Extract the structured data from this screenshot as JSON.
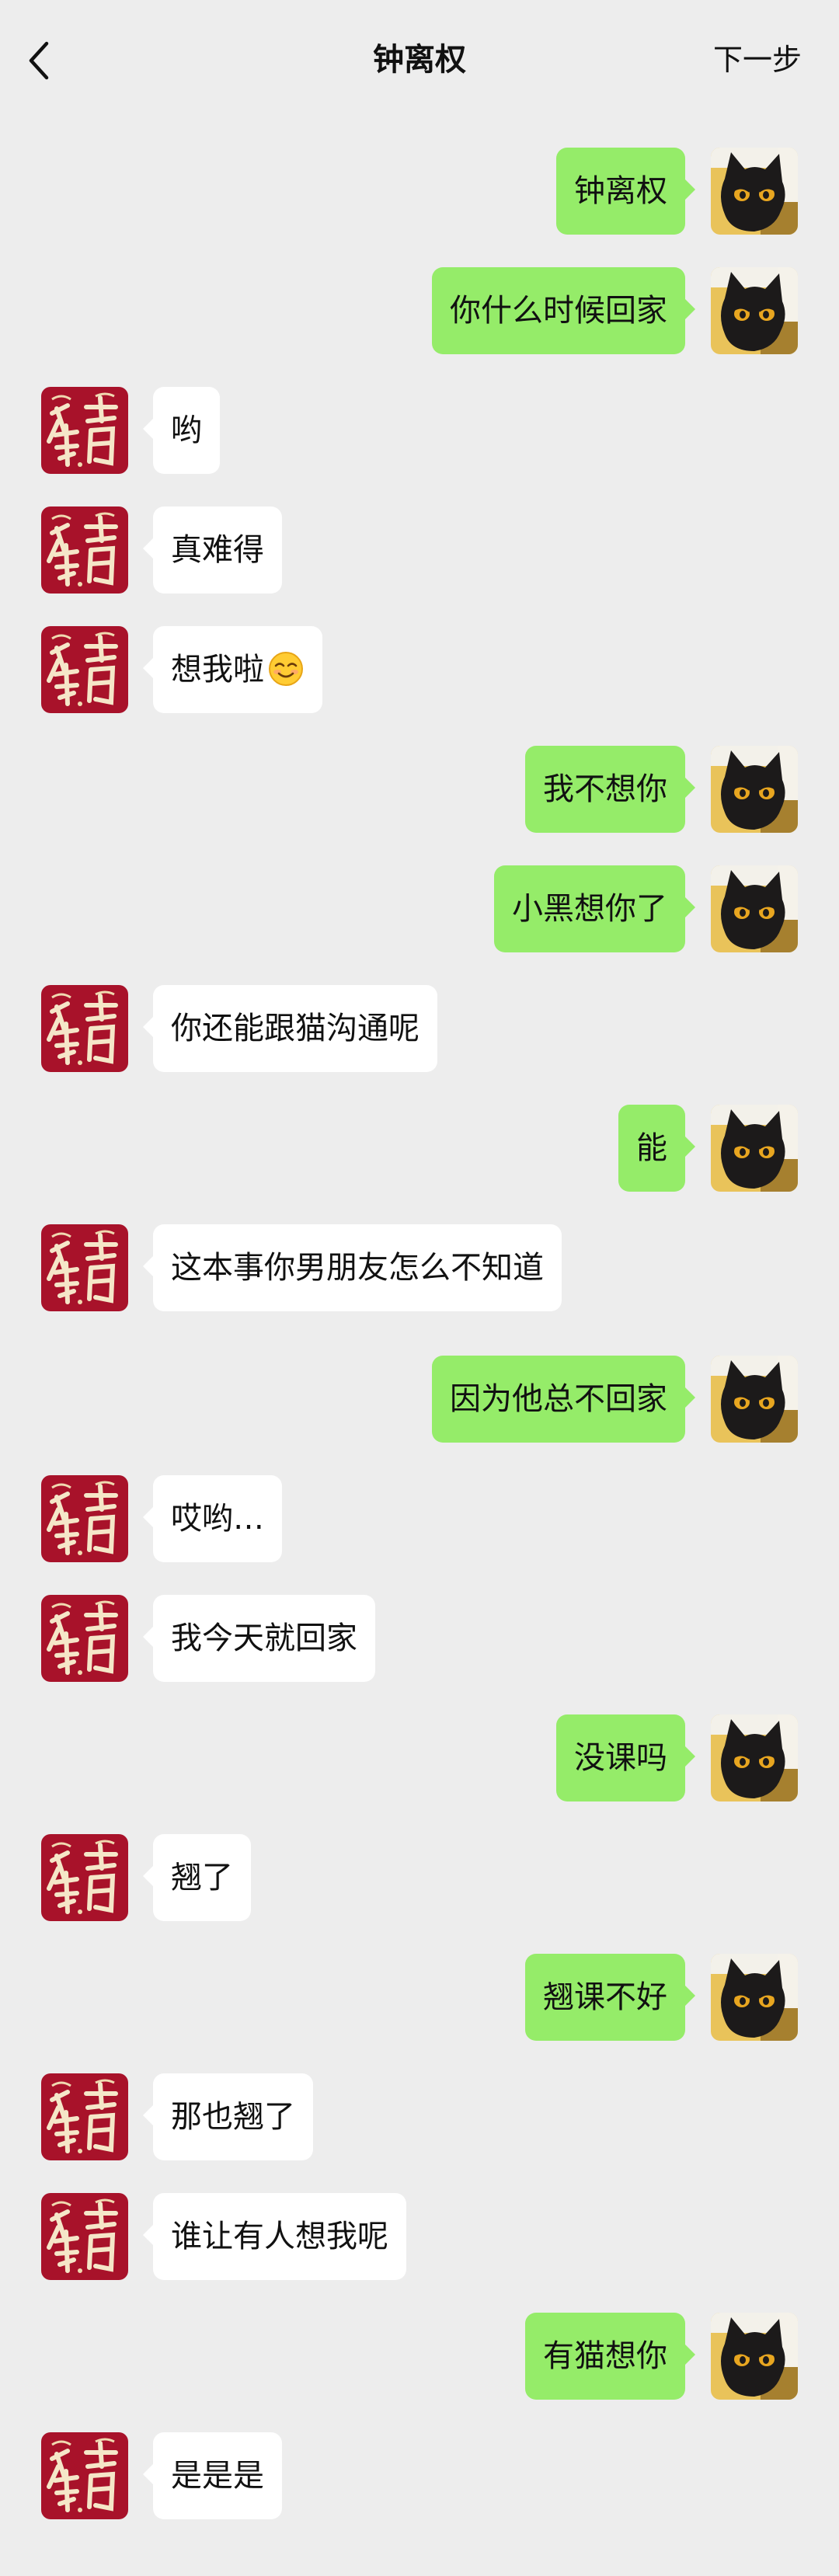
{
  "header": {
    "title": "钟离权",
    "next_label": "下一步"
  },
  "colors": {
    "background": "#ededed",
    "sent_bubble": "#95ec69",
    "received_bubble": "#ffffff",
    "contact_avatar": "#a8122a",
    "my_avatar_bg": "#e9c35a"
  },
  "messages": [
    {
      "side": "right",
      "text": "钟离权"
    },
    {
      "side": "right",
      "text": "你什么时候回家"
    },
    {
      "side": "left",
      "text": "哟"
    },
    {
      "side": "left",
      "text": "真难得"
    },
    {
      "side": "left",
      "text": "想我啦",
      "emoji": "smiling-face-emoji"
    },
    {
      "side": "right",
      "text": "我不想你"
    },
    {
      "side": "right",
      "text": "小黑想你了"
    },
    {
      "side": "left",
      "text": "你还能跟猫沟通呢"
    },
    {
      "side": "right",
      "text": "能"
    },
    {
      "side": "left",
      "text": "这本事你男朋友怎么不知道"
    },
    {
      "side": "right",
      "text": "因为他总不回家"
    },
    {
      "side": "left",
      "text": "哎哟…"
    },
    {
      "side": "left",
      "text": "我今天就回家"
    },
    {
      "side": "right",
      "text": "没课吗"
    },
    {
      "side": "left",
      "text": "翘了"
    },
    {
      "side": "right",
      "text": "翘课不好"
    },
    {
      "side": "left",
      "text": "那也翘了"
    },
    {
      "side": "left",
      "text": "谁让有人想我呢"
    },
    {
      "side": "right",
      "text": "有猫想你"
    },
    {
      "side": "left",
      "text": "是是是"
    }
  ]
}
